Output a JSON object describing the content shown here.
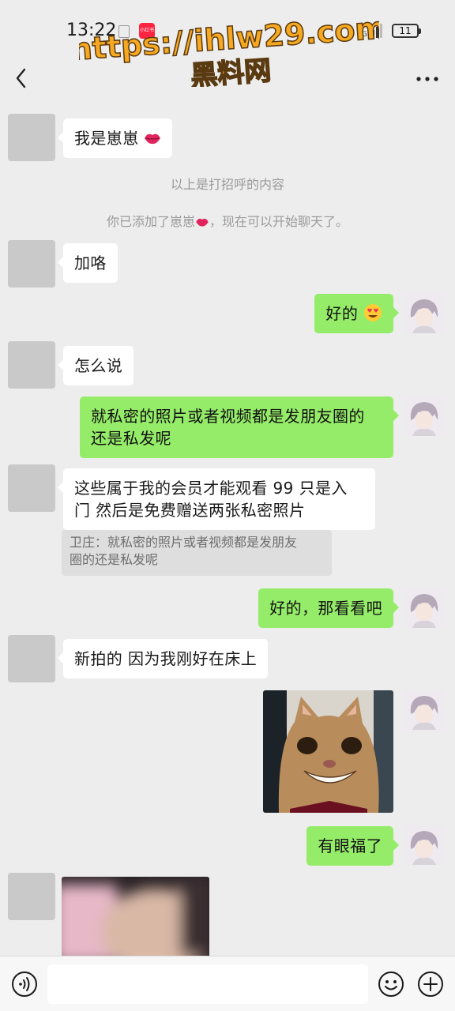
{
  "status_bar": {
    "time": "13:22",
    "app_icon_label": "小红书",
    "network_label": "4G",
    "battery": "11"
  },
  "watermark": {
    "url": "https://ihlw29.com",
    "name": "黑料网"
  },
  "messages": [
    {
      "side": "in",
      "text": "我是崽崽"
    },
    {
      "side": "system",
      "text": "以上是打招呼的内容"
    },
    {
      "side": "system",
      "text_before": "你已添加了崽崽",
      "text_after": "，现在可以开始聊天了。"
    },
    {
      "side": "in",
      "text": "加咯"
    },
    {
      "side": "out",
      "text": "好的"
    },
    {
      "side": "in",
      "text": "怎么说"
    },
    {
      "side": "out",
      "line1": "就私密的照片或者视频都是发朋友圈的",
      "line2": "还是私发呢"
    },
    {
      "side": "in",
      "line1": "这些属于我的会员才能观看 99 只是入",
      "line2": "门 然后是免费赠送两张私密照片"
    },
    {
      "side": "quote",
      "line1": "卫庄：就私密的照片或者视频都是发朋友",
      "line2": "圈的还是私发呢"
    },
    {
      "side": "out",
      "text": "好的，那看看吧"
    },
    {
      "side": "in",
      "text": "新拍的 因为我刚好在床上"
    },
    {
      "side": "out",
      "kind": "image",
      "icon": "smiling-cat-photo"
    },
    {
      "side": "out",
      "text": "有眼福了"
    },
    {
      "side": "in",
      "kind": "image",
      "icon": "blurred-photo"
    }
  ],
  "input": {
    "placeholder": "",
    "value": ""
  },
  "colors": {
    "background": "#ededed",
    "outgoing_bubble": "#95ec69",
    "incoming_bubble": "#ffffff",
    "watermark": "#f6a821"
  }
}
